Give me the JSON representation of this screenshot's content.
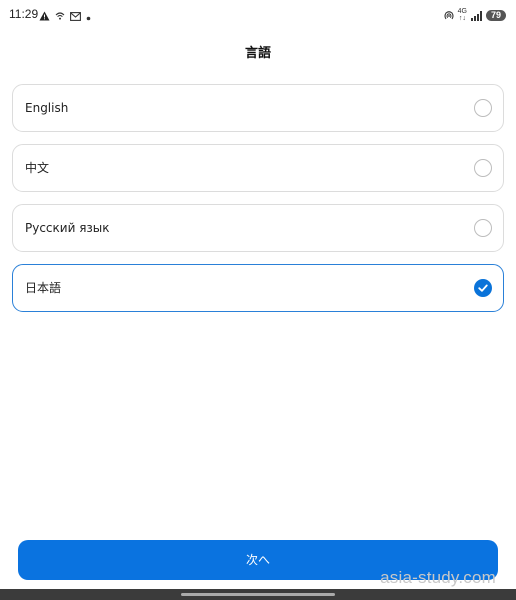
{
  "status_bar": {
    "time": "11:29",
    "left_icons": [
      "warning-icon",
      "wifi-call-icon",
      "gmail-icon",
      "dot-icon"
    ],
    "network_top": "4G",
    "network_bottom": "↑↓",
    "battery": "79"
  },
  "page": {
    "title": "言語"
  },
  "languages": [
    {
      "label": "English",
      "selected": false
    },
    {
      "label": "中文",
      "selected": false
    },
    {
      "label": "Русский язык",
      "selected": false
    },
    {
      "label": "日本語",
      "selected": true
    }
  ],
  "next_button": {
    "label": "次へ"
  },
  "watermark": "asia-study.com",
  "colors": {
    "accent": "#0a73e0",
    "selected_border": "#2a80d8",
    "option_border": "#dcdcdc"
  }
}
